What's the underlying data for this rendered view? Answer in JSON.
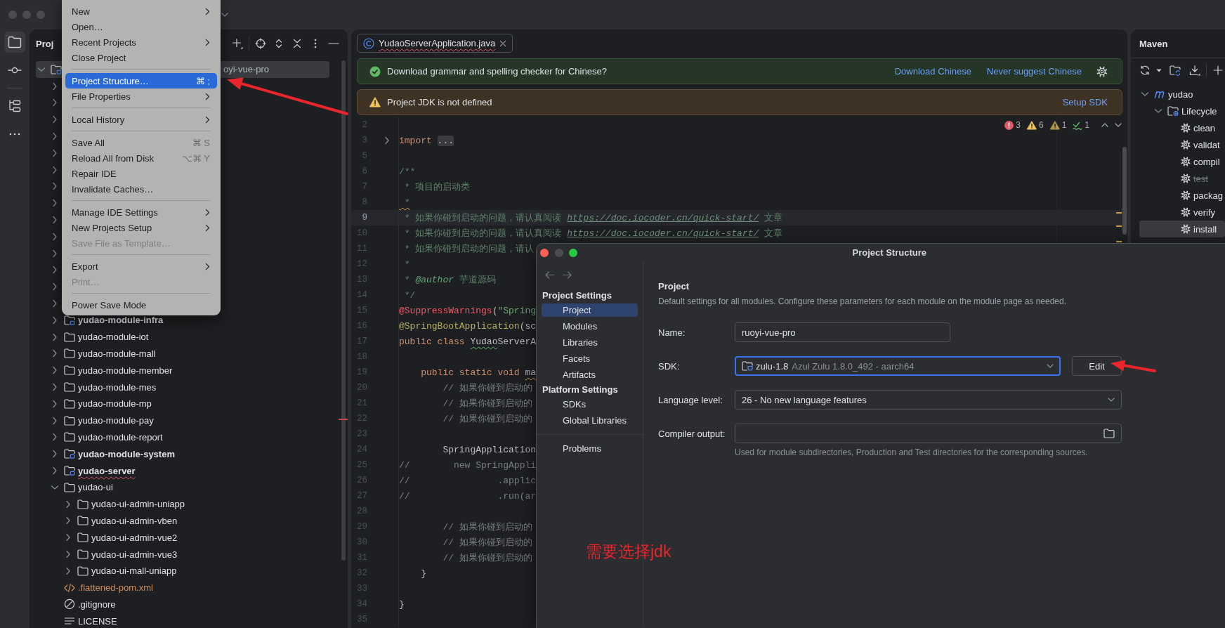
{
  "tool_strip": [
    {
      "kind": "project",
      "selected": true
    },
    {
      "kind": "commit",
      "selected": false
    },
    {
      "kind": "structure",
      "selected": false
    },
    {
      "kind": "more",
      "selected": false
    }
  ],
  "project_panel": {
    "title": "Proj",
    "tree": [
      {
        "kind": "root",
        "label": "oyi-vue-pro",
        "expanded": true,
        "selected": true,
        "misspelled": false,
        "children": [
          {
            "kind": "covered",
            "expanded": false
          },
          {
            "kind": "covered",
            "expanded": false
          },
          {
            "kind": "covered",
            "expanded": false
          },
          {
            "kind": "covered",
            "expanded": false
          },
          {
            "kind": "covered",
            "expanded": false
          },
          {
            "kind": "covered",
            "expanded": false
          },
          {
            "kind": "covered",
            "expanded": false
          },
          {
            "kind": "covered",
            "expanded": false
          },
          {
            "kind": "covered",
            "expanded": false
          },
          {
            "kind": "covered",
            "expanded": false
          },
          {
            "kind": "covered",
            "expanded": false
          },
          {
            "kind": "covered",
            "expanded": false
          },
          {
            "kind": "covered",
            "expanded": false
          },
          {
            "kind": "covered",
            "expanded": false
          },
          {
            "kind": "module",
            "label": "yudao-module-infra",
            "expanded": false,
            "selected": false,
            "misspelled": false
          },
          {
            "kind": "folder",
            "label": "yudao-module-iot",
            "expanded": false,
            "selected": false,
            "misspelled": false
          },
          {
            "kind": "folder",
            "label": "yudao-module-mall",
            "expanded": false,
            "selected": false,
            "misspelled": false
          },
          {
            "kind": "folder",
            "label": "yudao-module-member",
            "expanded": false,
            "selected": false,
            "misspelled": false
          },
          {
            "kind": "folder",
            "label": "yudao-module-mes",
            "expanded": false,
            "selected": false,
            "misspelled": false
          },
          {
            "kind": "folder",
            "label": "yudao-module-mp",
            "expanded": false,
            "selected": false,
            "misspelled": false
          },
          {
            "kind": "folder",
            "label": "yudao-module-pay",
            "expanded": false,
            "selected": false,
            "misspelled": false
          },
          {
            "kind": "folder",
            "label": "yudao-module-report",
            "expanded": false,
            "selected": false,
            "misspelled": false
          },
          {
            "kind": "module",
            "label": "yudao-module-system",
            "expanded": false,
            "selected": false,
            "misspelled": false
          },
          {
            "kind": "module",
            "label": "yudao-server",
            "expanded": false,
            "selected": false,
            "misspelled": true
          },
          {
            "kind": "folder",
            "label": "yudao-ui",
            "expanded": true,
            "selected": false,
            "misspelled": false,
            "children": [
              {
                "kind": "folder",
                "label": "yudao-ui-admin-uniapp",
                "expanded": false,
                "selected": false,
                "misspelled": false
              },
              {
                "kind": "folder",
                "label": "yudao-ui-admin-vben",
                "expanded": false,
                "selected": false,
                "misspelled": false
              },
              {
                "kind": "folder",
                "label": "yudao-ui-admin-vue2",
                "expanded": false,
                "selected": false,
                "misspelled": false
              },
              {
                "kind": "folder",
                "label": "yudao-ui-admin-vue3",
                "expanded": false,
                "selected": false,
                "misspelled": false
              },
              {
                "kind": "folder",
                "label": "yudao-ui-mall-uniapp",
                "expanded": false,
                "selected": false,
                "misspelled": false
              }
            ]
          },
          {
            "kind": "xml",
            "label": ".flattened-pom.xml",
            "selected": false,
            "misspelled": false,
            "color": "#cf8e5f"
          },
          {
            "kind": "ignore",
            "label": ".gitignore",
            "selected": false,
            "misspelled": false
          },
          {
            "kind": "text",
            "label": "LICENSE",
            "selected": false,
            "misspelled": false
          }
        ]
      }
    ]
  },
  "file_menu": {
    "items": [
      {
        "kind": "item",
        "label": "New",
        "submenu": true,
        "selected": false,
        "disabled": false
      },
      {
        "kind": "item",
        "label": "Open…",
        "submenu": false,
        "selected": false,
        "disabled": false
      },
      {
        "kind": "item",
        "label": "Recent Projects",
        "submenu": true,
        "selected": false,
        "disabled": false
      },
      {
        "kind": "item",
        "label": "Close Project",
        "submenu": false,
        "selected": false,
        "disabled": false
      },
      {
        "kind": "separator"
      },
      {
        "kind": "item",
        "label": "Project Structure…",
        "shortcut": "⌘ ;",
        "submenu": false,
        "selected": true,
        "disabled": false
      },
      {
        "kind": "item",
        "label": "File Properties",
        "submenu": true,
        "selected": false,
        "disabled": false
      },
      {
        "kind": "separator"
      },
      {
        "kind": "item",
        "label": "Local History",
        "submenu": true,
        "selected": false,
        "disabled": false
      },
      {
        "kind": "separator"
      },
      {
        "kind": "item",
        "label": "Save All",
        "shortcut": "⌘ S",
        "submenu": false,
        "selected": false,
        "disabled": false
      },
      {
        "kind": "item",
        "label": "Reload All from Disk",
        "shortcut": "⌥⌘ Y",
        "submenu": false,
        "selected": false,
        "disabled": false
      },
      {
        "kind": "item",
        "label": "Repair IDE",
        "submenu": false,
        "selected": false,
        "disabled": false
      },
      {
        "kind": "item",
        "label": "Invalidate Caches…",
        "submenu": false,
        "selected": false,
        "disabled": false
      },
      {
        "kind": "separator"
      },
      {
        "kind": "item",
        "label": "Manage IDE Settings",
        "submenu": true,
        "selected": false,
        "disabled": false
      },
      {
        "kind": "item",
        "label": "New Projects Setup",
        "submenu": true,
        "selected": false,
        "disabled": false
      },
      {
        "kind": "item",
        "label": "Save File as Template…",
        "submenu": false,
        "selected": false,
        "disabled": true
      },
      {
        "kind": "separator"
      },
      {
        "kind": "item",
        "label": "Export",
        "submenu": true,
        "selected": false,
        "disabled": false
      },
      {
        "kind": "item",
        "label": "Print…",
        "submenu": false,
        "selected": false,
        "disabled": true
      },
      {
        "kind": "separator"
      },
      {
        "kind": "item",
        "label": "Power Save Mode",
        "submenu": false,
        "selected": false,
        "disabled": false
      }
    ]
  },
  "editor": {
    "tabs": [
      {
        "label": "YudaoServerApplication.java",
        "selected": true,
        "misspelled": true
      }
    ],
    "notifications": [
      {
        "kind": "info",
        "text": "Download grammar and spelling checker for Chinese?",
        "actions": [
          "Download Chinese",
          "Never suggest Chinese"
        ]
      },
      {
        "kind": "warning",
        "text": "Project JDK is not defined",
        "actions": [
          "Setup SDK"
        ]
      }
    ],
    "inspections": [
      {
        "kind": "error",
        "count": "3"
      },
      {
        "kind": "warning",
        "count": "6"
      },
      {
        "kind": "weak_warning",
        "count": "1"
      },
      {
        "kind": "typo",
        "count": "1"
      }
    ],
    "lines": [
      {
        "number": "2",
        "current": false,
        "folded": false
      },
      {
        "number": "3",
        "current": false,
        "folded": true,
        "tokens": [
          {
            "kind": "keyword",
            "text": "import "
          },
          {
            "kind": "folded",
            "text": "..."
          }
        ]
      },
      {
        "number": "5",
        "current": false,
        "folded": false
      },
      {
        "number": "6",
        "current": false,
        "folded": false,
        "tokens": [
          {
            "kind": "doc",
            "text": "/**"
          }
        ]
      },
      {
        "number": "7",
        "current": false,
        "folded": false,
        "tokens": [
          {
            "kind": "doc",
            "text": " * 项目的启动类"
          }
        ]
      },
      {
        "number": "8",
        "current": false,
        "folded": false,
        "tokens": [
          {
            "kind": "doc_warning",
            "text": " *"
          }
        ]
      },
      {
        "number": "9",
        "current": true,
        "folded": false,
        "tokens": [
          {
            "kind": "doc",
            "text": " * 如果你碰到启动的问题，请认真阅读 "
          },
          {
            "kind": "link",
            "text": "https://doc.iocoder.cn/quick-start/"
          },
          {
            "kind": "doc",
            "text": " 文章"
          }
        ]
      },
      {
        "number": "10",
        "current": false,
        "folded": false,
        "tokens": [
          {
            "kind": "doc",
            "text": " * 如果你碰到启动的问题，请认真阅读 "
          },
          {
            "kind": "link",
            "text": "https://doc.iocoder.cn/quick-start/"
          },
          {
            "kind": "doc",
            "text": " 文章"
          }
        ]
      },
      {
        "number": "11",
        "current": false,
        "folded": false,
        "tokens": [
          {
            "kind": "doc",
            "text": " * 如果你碰到启动的问题，请认"
          }
        ]
      },
      {
        "number": "12",
        "current": false,
        "folded": false,
        "tokens": [
          {
            "kind": "doc",
            "text": " *"
          }
        ]
      },
      {
        "number": "13",
        "current": false,
        "folded": false,
        "tokens": [
          {
            "kind": "doc",
            "text": " * "
          },
          {
            "kind": "doc_tag",
            "text": "@author"
          },
          {
            "kind": "doc",
            "text": " 芋道源码"
          }
        ]
      },
      {
        "number": "14",
        "current": false,
        "folded": false,
        "tokens": [
          {
            "kind": "doc",
            "text": " */"
          }
        ]
      },
      {
        "number": "15",
        "current": false,
        "folded": false,
        "tokens": [
          {
            "kind": "error",
            "text": "@SuppressWarnings"
          },
          {
            "kind": "plain",
            "text": "("
          },
          {
            "kind": "string",
            "text": "\"Spring"
          }
        ]
      },
      {
        "number": "16",
        "current": false,
        "folded": false,
        "tokens": [
          {
            "kind": "annotation",
            "text": "@SpringBootApplication"
          },
          {
            "kind": "plain",
            "text": "(sc"
          }
        ]
      },
      {
        "number": "17",
        "current": false,
        "folded": false,
        "tokens": [
          {
            "kind": "keyword",
            "text": "public class "
          },
          {
            "kind": "plain_typo",
            "text": "Yudao"
          },
          {
            "kind": "plain",
            "text": "ServerA"
          }
        ]
      },
      {
        "number": "18",
        "current": false,
        "folded": false
      },
      {
        "number": "19",
        "current": false,
        "folded": false,
        "tokens": [
          {
            "kind": "keyword",
            "text": "    public static void "
          },
          {
            "kind": "plain_warning",
            "text": "ma"
          }
        ]
      },
      {
        "number": "20",
        "current": false,
        "folded": false,
        "tokens": [
          {
            "kind": "comment",
            "text": "        // 如果你碰到启动的"
          }
        ]
      },
      {
        "number": "21",
        "current": false,
        "folded": false,
        "tokens": [
          {
            "kind": "comment",
            "text": "        // 如果你碰到启动的"
          }
        ]
      },
      {
        "number": "22",
        "current": false,
        "folded": false,
        "tokens": [
          {
            "kind": "comment",
            "text": "        // 如果你碰到启动的"
          }
        ]
      },
      {
        "number": "23",
        "current": false,
        "folded": false
      },
      {
        "number": "24",
        "current": false,
        "folded": false,
        "tokens": [
          {
            "kind": "plain",
            "text": "        SpringApplication"
          }
        ]
      },
      {
        "number": "25",
        "current": false,
        "folded": false,
        "tokens": [
          {
            "kind": "comment",
            "text": "//        new SpringAppli"
          }
        ]
      },
      {
        "number": "26",
        "current": false,
        "folded": false,
        "tokens": [
          {
            "kind": "comment",
            "text": "//                .applic"
          }
        ]
      },
      {
        "number": "27",
        "current": false,
        "folded": false,
        "tokens": [
          {
            "kind": "comment",
            "text": "//                .run(ar"
          }
        ]
      },
      {
        "number": "28",
        "current": false,
        "folded": false
      },
      {
        "number": "29",
        "current": false,
        "folded": false,
        "tokens": [
          {
            "kind": "comment",
            "text": "        // 如果你碰到启动的"
          }
        ]
      },
      {
        "number": "30",
        "current": false,
        "folded": false,
        "tokens": [
          {
            "kind": "comment",
            "text": "        // 如果你碰到启动的"
          }
        ]
      },
      {
        "number": "31",
        "current": false,
        "folded": false,
        "tokens": [
          {
            "kind": "comment",
            "text": "        // 如果你碰到启动的"
          }
        ]
      },
      {
        "number": "32",
        "current": false,
        "folded": false,
        "tokens": [
          {
            "kind": "plain",
            "text": "    }"
          }
        ]
      },
      {
        "number": "33",
        "current": false,
        "folded": false
      },
      {
        "number": "34",
        "current": false,
        "folded": false,
        "tokens": [
          {
            "kind": "plain",
            "text": "}"
          }
        ]
      },
      {
        "number": "35",
        "current": false,
        "folded": false
      }
    ]
  },
  "maven_panel": {
    "title": "Maven",
    "tree": [
      {
        "kind": "project",
        "label": "yudao",
        "expanded": true,
        "selected": false,
        "children": [
          {
            "kind": "lifecycle",
            "label": "Lifecycle",
            "expanded": true,
            "selected": false,
            "children": [
              {
                "kind": "goal",
                "label": "clean",
                "selected": false,
                "skipped": false
              },
              {
                "kind": "goal",
                "label": "validat",
                "selected": false,
                "skipped": false
              },
              {
                "kind": "goal",
                "label": "compil",
                "selected": false,
                "skipped": false
              },
              {
                "kind": "goal",
                "label": "test",
                "selected": false,
                "skipped": true
              },
              {
                "kind": "goal",
                "label": "packag",
                "selected": false,
                "skipped": false
              },
              {
                "kind": "goal",
                "label": "verify",
                "selected": false,
                "skipped": false
              },
              {
                "kind": "goal",
                "label": "install",
                "selected": true,
                "skipped": false
              }
            ]
          }
        ]
      }
    ]
  },
  "dialog": {
    "title": "Project Structure",
    "nav": [
      {
        "kind": "header",
        "label": "Project Settings"
      },
      {
        "kind": "item",
        "label": "Project",
        "selected": true
      },
      {
        "kind": "item",
        "label": "Modules",
        "selected": false
      },
      {
        "kind": "item",
        "label": "Libraries",
        "selected": false
      },
      {
        "kind": "item",
        "label": "Facets",
        "selected": false
      },
      {
        "kind": "item",
        "label": "Artifacts",
        "selected": false
      },
      {
        "kind": "header",
        "label": "Platform Settings"
      },
      {
        "kind": "item",
        "label": "SDKs",
        "selected": false
      },
      {
        "kind": "item",
        "label": "Global Libraries",
        "selected": false
      },
      {
        "kind": "separator"
      },
      {
        "kind": "item",
        "label": "Problems",
        "selected": false
      }
    ],
    "section_title": "Project",
    "description": "Default settings for all modules. Configure these parameters for each module on the module page as needed.",
    "fields": [
      {
        "kind": "text",
        "label": "Name:",
        "value": "ruoyi-vue-pro",
        "focused": false
      },
      {
        "kind": "sdk",
        "label": "SDK:",
        "value": "zulu-1.8",
        "detail": "Azul Zulu 1.8.0_492 - aarch64",
        "focused": true,
        "button": "Edit"
      },
      {
        "kind": "select",
        "label": "Language level:",
        "value": "26 - No new language features",
        "focused": false
      },
      {
        "kind": "path",
        "label": "Compiler output:",
        "focused": false,
        "hint": "Used for module subdirectories, Production and Test directories for the corresponding sources."
      }
    ]
  },
  "annotation": {
    "note": "需要选择jdk"
  }
}
